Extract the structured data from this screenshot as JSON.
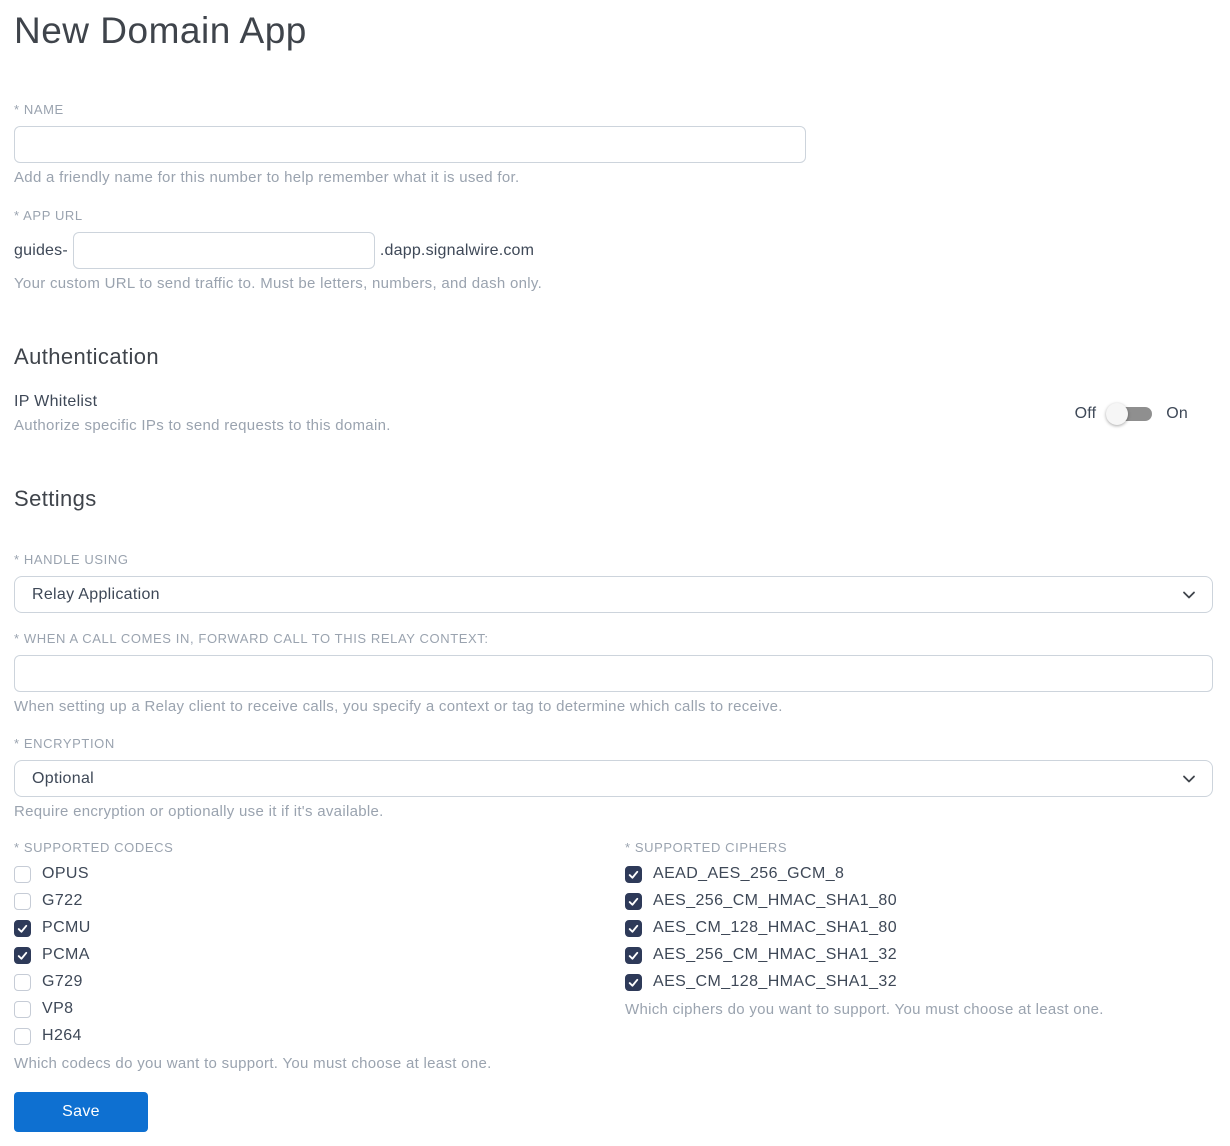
{
  "page_title": "New Domain App",
  "name_field": {
    "label": "* NAME",
    "value": "",
    "helper": "Add a friendly name for this number to help remember what it is used for."
  },
  "app_url_field": {
    "label": "* APP URL",
    "prefix": "guides-",
    "value": "",
    "suffix": ".dapp.signalwire.com",
    "helper": "Your custom URL to send traffic to. Must be letters, numbers, and dash only."
  },
  "authentication": {
    "heading": "Authentication",
    "ip_whitelist": {
      "label": "IP Whitelist",
      "helper": "Authorize specific IPs to send requests to this domain.",
      "off_label": "Off",
      "on_label": "On",
      "is_on": false,
      "state": "off"
    }
  },
  "settings": {
    "heading": "Settings",
    "handle_using": {
      "label": "* HANDLE USING",
      "value": "Relay Application"
    },
    "relay_context": {
      "label": "* WHEN A CALL COMES IN, FORWARD CALL TO THIS RELAY CONTEXT:",
      "value": "",
      "helper": "When setting up a Relay client to receive calls, you specify a context or tag to determine which calls to receive."
    },
    "encryption": {
      "label": "* ENCRYPTION",
      "value": "Optional",
      "helper": "Require encryption or optionally use it if it's available."
    },
    "codecs": {
      "label": "* SUPPORTED CODECS",
      "helper": "Which codecs do you want to support. You must choose at least one.",
      "items": [
        {
          "label": "OPUS",
          "checked": false
        },
        {
          "label": "G722",
          "checked": false
        },
        {
          "label": "PCMU",
          "checked": true
        },
        {
          "label": "PCMA",
          "checked": true
        },
        {
          "label": "G729",
          "checked": false
        },
        {
          "label": "VP8",
          "checked": false
        },
        {
          "label": "H264",
          "checked": false
        }
      ]
    },
    "ciphers": {
      "label": "* SUPPORTED CIPHERS",
      "helper": "Which ciphers do you want to support. You must choose at least one.",
      "items": [
        {
          "label": "AEAD_AES_256_GCM_8",
          "checked": true
        },
        {
          "label": "AES_256_CM_HMAC_SHA1_80",
          "checked": true
        },
        {
          "label": "AES_CM_128_HMAC_SHA1_80",
          "checked": true
        },
        {
          "label": "AES_256_CM_HMAC_SHA1_32",
          "checked": true
        },
        {
          "label": "AES_CM_128_HMAC_SHA1_32",
          "checked": true
        }
      ]
    }
  },
  "save_button": {
    "label": "Save"
  },
  "colors": {
    "accent_blue": "#0e70d1",
    "checkbox_checked": "#2e3a59",
    "toggle_track": "#8f8f8f",
    "toggle_knob": "#f6f6f6",
    "input_border": "#cdd4dc",
    "muted_text": "#9aa3af",
    "body_text": "#3e4857"
  }
}
